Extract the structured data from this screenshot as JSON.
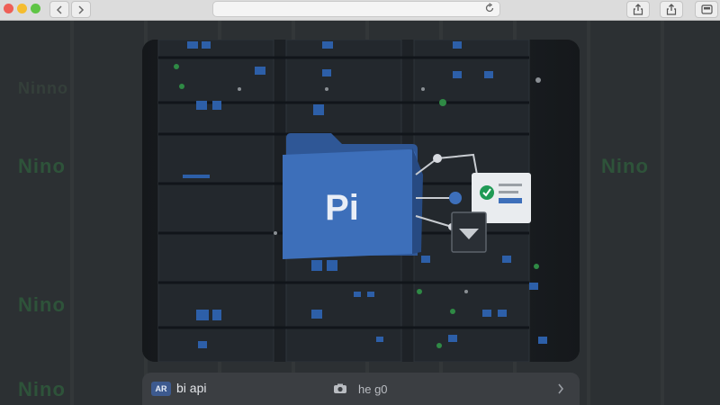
{
  "browser": {
    "controls": [
      "close",
      "minimize",
      "maximize"
    ],
    "nav": [
      "back-icon",
      "forward-icon"
    ],
    "address_bar": {
      "value": "",
      "icon": "reload-icon"
    },
    "toolbar_icons": [
      "share-icon",
      "share-icon",
      "tabs-icon"
    ]
  },
  "background": {
    "watermark_words": [
      "Ninno",
      "Nino",
      "Nino",
      "Nino",
      "Nino"
    ]
  },
  "card": {
    "folder_label": "Pi",
    "icons": [
      "folder-icon",
      "checkmark-icon",
      "dropdown-triangle-icon",
      "network-node-icon"
    ]
  },
  "bottom_bar": {
    "badge": "AR",
    "title": "bi api",
    "subtitle": "he g0",
    "icons": [
      "camera-icon",
      "chevron-right-icon"
    ]
  },
  "colors": {
    "accent_blue": "#3d6fba",
    "check_green": "#1f9a55",
    "watermark_green": "#2f5a3c"
  }
}
